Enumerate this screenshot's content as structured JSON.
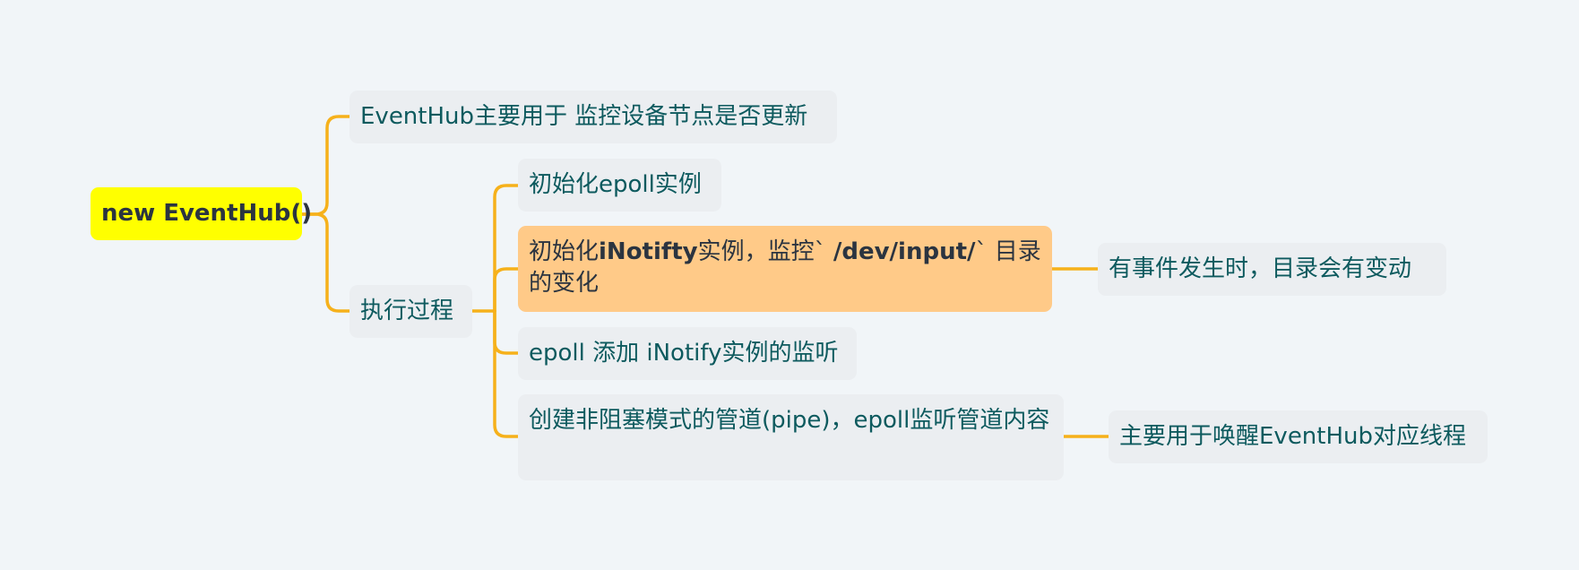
{
  "root": {
    "label": "new EventHub()"
  },
  "branch_purpose": {
    "label": "EventHub主要用于 监控设备节点是否更新"
  },
  "branch_process": {
    "label": "执行过程"
  },
  "steps": [
    {
      "label": "初始化epoll实例"
    },
    {
      "parts": [
        "初始化",
        "iNotifty",
        "实例，监控` ",
        "/dev/input/",
        "` 目录的变化"
      ]
    },
    {
      "label": "epoll 添加 iNotify实例的监听"
    },
    {
      "label": "创建非阻塞模式的管道(pipe)，epoll监听管道内容"
    }
  ],
  "notes": {
    "inotify": "有事件发生时，目录会有变动",
    "pipe": "主要用于唤醒EventHub对应线程"
  },
  "colors": {
    "background": "#f1f5f8",
    "connector": "#f6b11b",
    "root_fill": "#ffff00",
    "highlight_fill": "#ffca88",
    "node_fill": "#ebeef1",
    "node_text": "#0d5a5e"
  }
}
